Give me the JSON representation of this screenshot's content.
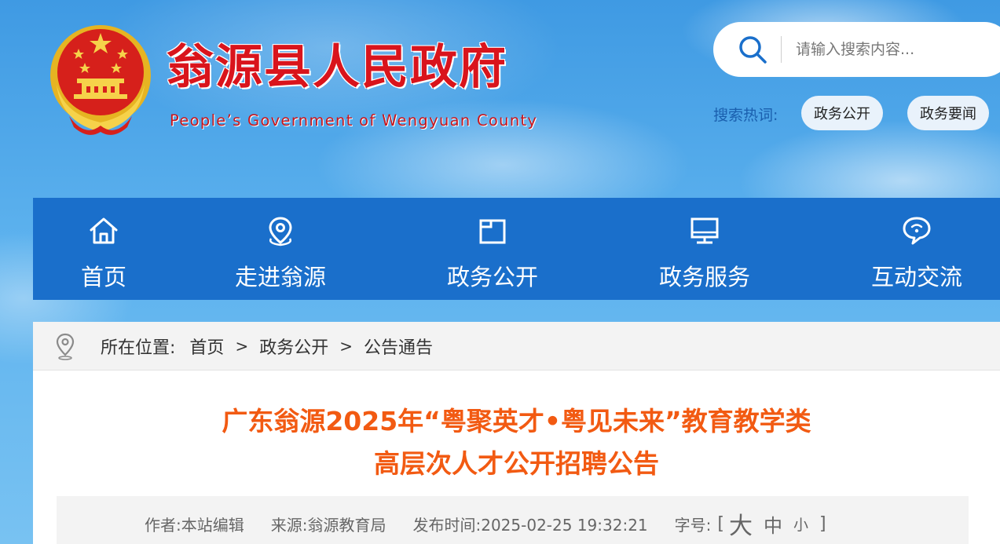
{
  "header": {
    "title": "翁源县人民政府",
    "subtitle": "People’s Government of Wengyuan County",
    "emblem_icon": "national-emblem-icon"
  },
  "search": {
    "placeholder": "请输入搜索内容...",
    "icon": "search-icon",
    "hot_label": "搜索热词:",
    "hot_tags": [
      "政务公开",
      "政务要闻"
    ]
  },
  "nav": {
    "items": [
      {
        "label": "首页",
        "icon": "home-icon"
      },
      {
        "label": "走进翁源",
        "icon": "location-pin-icon"
      },
      {
        "label": "政务公开",
        "icon": "folder-icon"
      },
      {
        "label": "政务服务",
        "icon": "monitor-icon"
      },
      {
        "label": "互动交流",
        "icon": "chat-bubble-icon"
      }
    ]
  },
  "breadcrumb": {
    "prefix": "所在位置:",
    "items": [
      "首页",
      "政务公开",
      "公告通告"
    ],
    "separator": ">"
  },
  "article": {
    "title_line1": "广东翁源2025年“粤聚英才•粤见未来”教育教学类",
    "title_line2": "高层次人才公开招聘公告",
    "meta": {
      "author": "作者:本站编辑",
      "source": "来源:翁源教育局",
      "published": "发布时间:2025-02-25 19:32:21",
      "font_size_label": "字号:",
      "bracket_open": "[",
      "bracket_close": "]",
      "sizes": [
        "大",
        "中",
        "小"
      ]
    }
  },
  "colors": {
    "nav_bg": "#1a6fcb",
    "title_red": "#d9141c",
    "article_title_orange": "#f25a12",
    "hot_label_blue": "#1a5fae"
  }
}
